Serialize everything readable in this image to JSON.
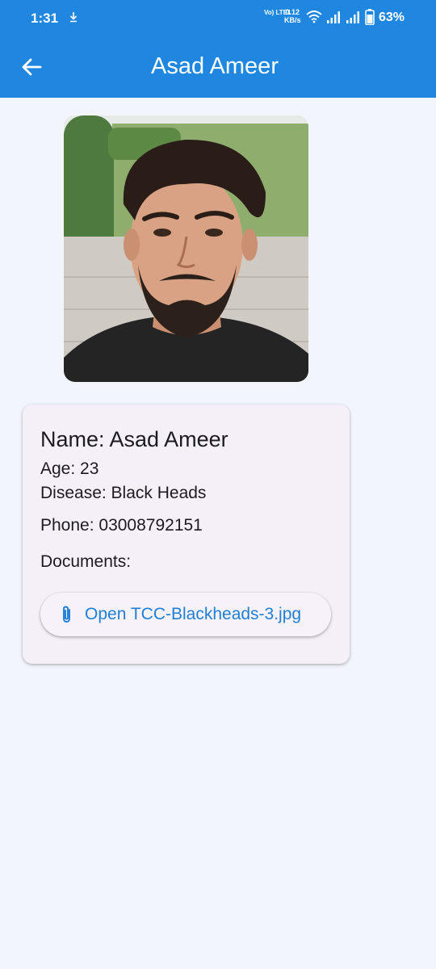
{
  "status_bar": {
    "time": "1:31",
    "network_type": "Vo) LTE1",
    "speed_value": "0.12",
    "speed_unit": "KB/s",
    "battery_percent": "63%",
    "icons": [
      "download-icon",
      "wifi-icon",
      "signal-icon",
      "signal-icon",
      "battery-icon"
    ]
  },
  "app_bar": {
    "title": "Asad Ameer",
    "back_icon": "arrow-left-icon",
    "color": "#1f87e0"
  },
  "profile": {
    "photo": "profile-photo",
    "name_label": "Name: Asad Ameer",
    "age_label": "Age: 23",
    "disease_label": "Disease: Black Heads",
    "phone_label": "Phone: 03008792151",
    "documents_label": "Documents:"
  },
  "documents": [
    {
      "label": "Open TCC-Blackheads-3.jpg",
      "icon": "paperclip-icon"
    }
  ],
  "colors": {
    "accent": "#1f87e0",
    "link": "#1f7fd4",
    "background": "#f2f5fb",
    "card": "#f5f0f8"
  }
}
